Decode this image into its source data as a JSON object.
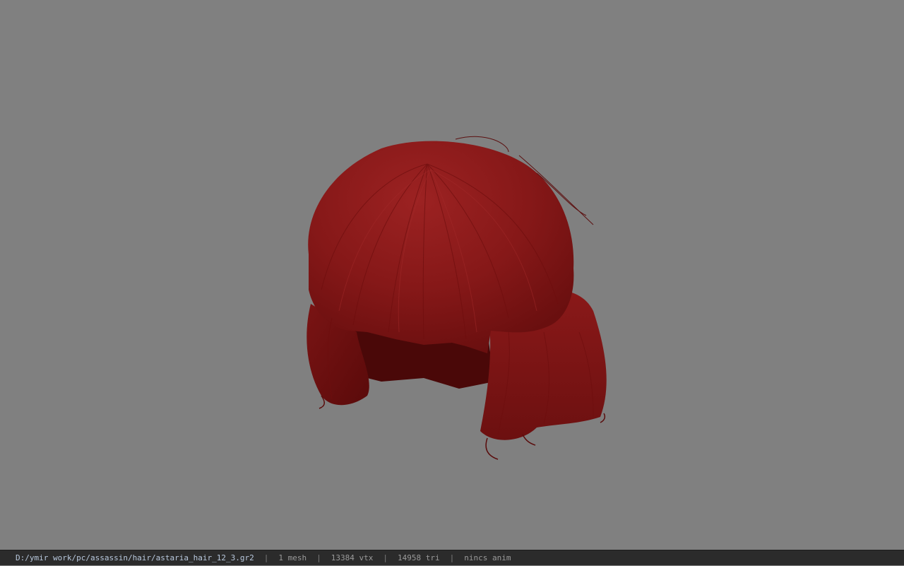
{
  "viewport": {
    "background": "#808080",
    "model_color": "#8b1a1a"
  },
  "status_bar": {
    "file_path": "D:/ymir work/pc/assassin/hair/astaria_hair_12_3.gr2",
    "separator": "|",
    "mesh_count": "1 mesh",
    "vertex_count": "13384 vtx",
    "triangle_count": "14958 tri",
    "anim_info": "nincs anim"
  }
}
